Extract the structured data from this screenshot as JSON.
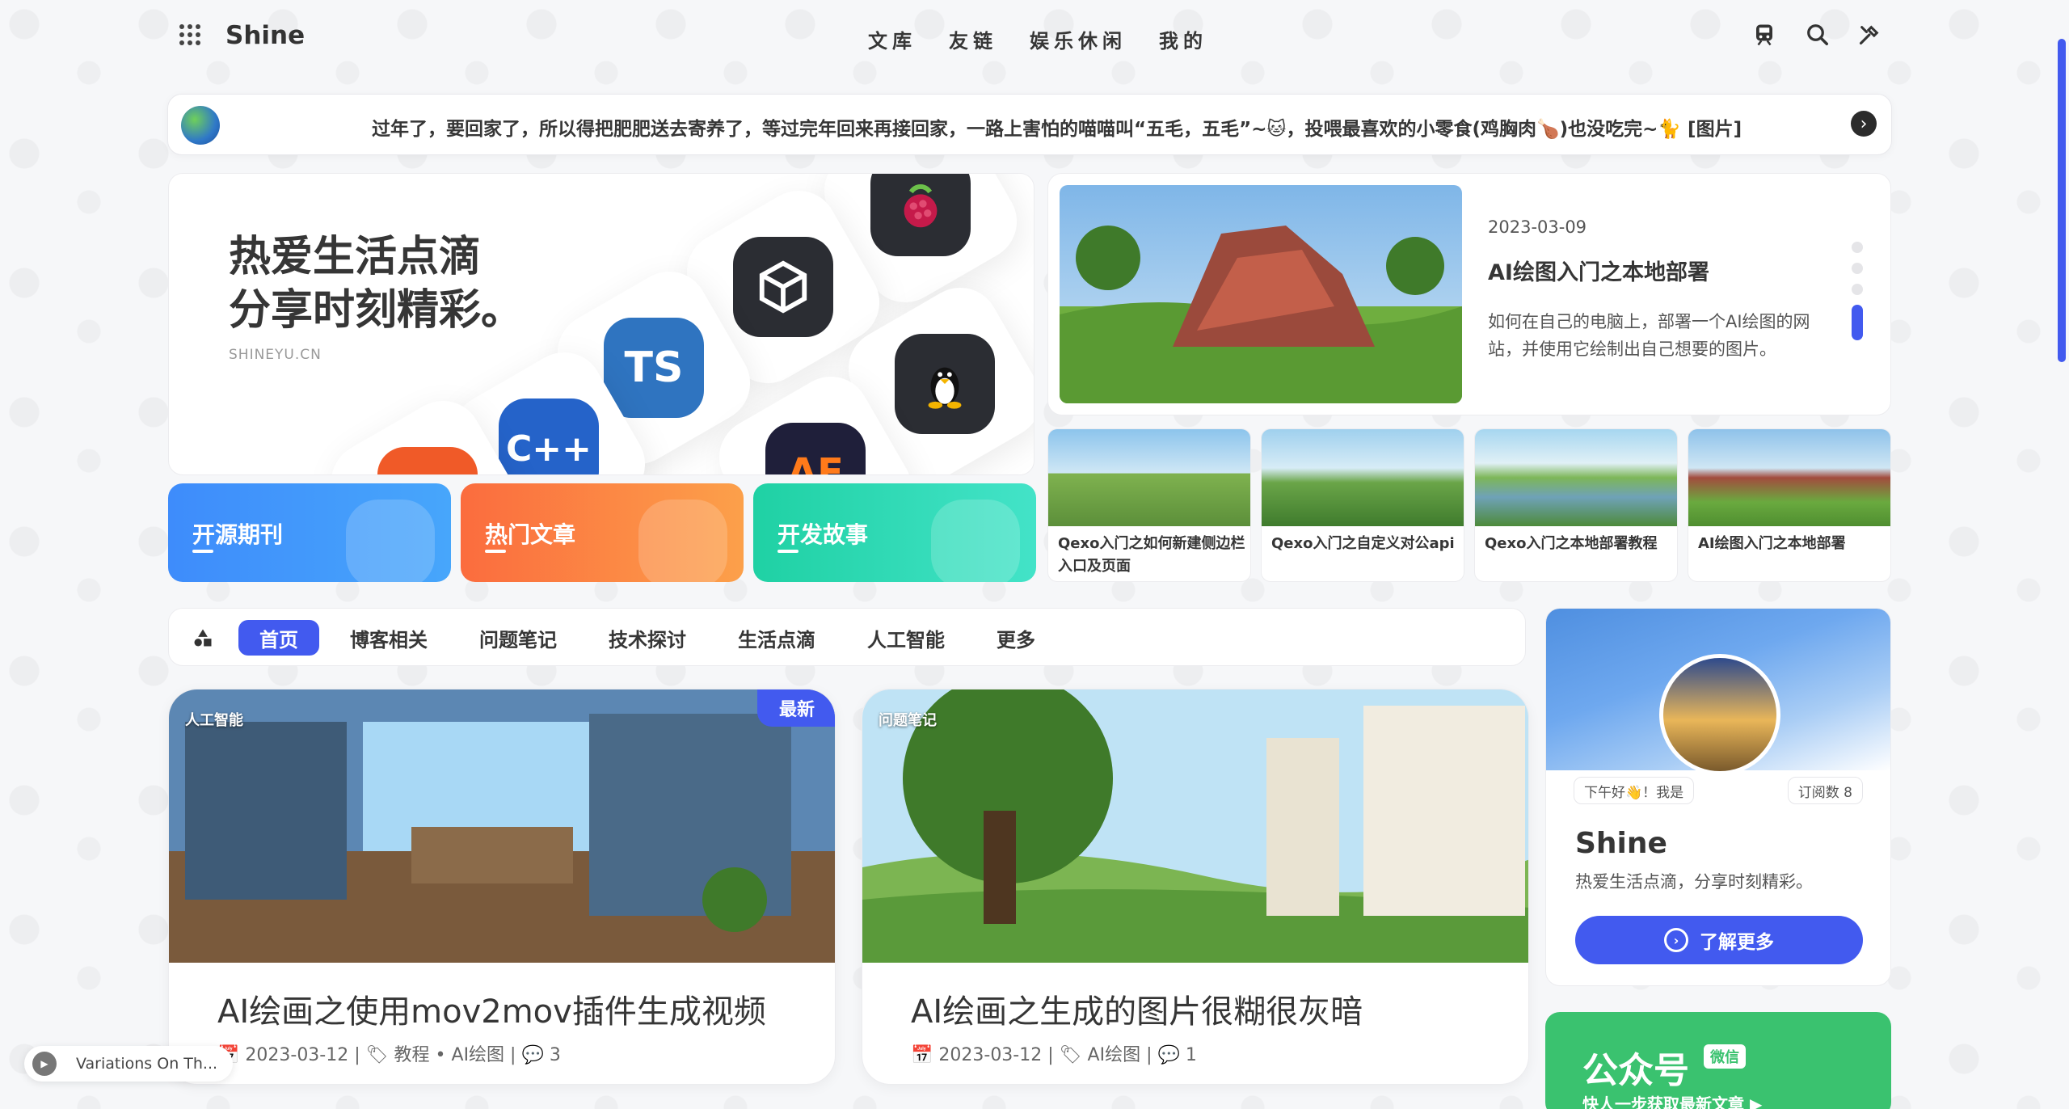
{
  "header": {
    "logo": "Shine",
    "nav": [
      "文库",
      "友链",
      "娱乐休闲",
      "我的"
    ]
  },
  "announcement": {
    "text": "过年了，要回家了，所以得把肥肥送去寄养了，等过完年回来再接回家，一路上害怕的喵喵叫“五毛，五毛”~🐱，投喂最喜欢的小零食(鸡胸肉🍗)也没吃完~🐈 [图片]"
  },
  "hero": {
    "title_line1": "热爱生活点滴",
    "title_line2": "分享时刻精彩。",
    "subtitle": "SHINEYU.CN",
    "tiles": [
      "TS",
      "C++",
      "AE"
    ]
  },
  "categories": [
    {
      "label": "开源期刊",
      "color_from": "#3e8cfb",
      "color_to": "#47a6fb"
    },
    {
      "label": "热门文章",
      "color_from": "#fb7c3e",
      "color_to": "#fca04a"
    },
    {
      "label": "开发故事",
      "color_from": "#22d3a6",
      "color_to": "#3fe0c3"
    }
  ],
  "featured": {
    "date": "2023-03-09",
    "title": "AI绘图入门之本地部署",
    "description": "如何在自己的电脑上，部署一个AI绘图的网站，并使用它绘制出自己想要的图片。"
  },
  "mini_posts": [
    {
      "title": "Qexo入门之如何新建侧边栏入口及页面"
    },
    {
      "title": "Qexo入门之自定义对公api"
    },
    {
      "title": "Qexo入门之本地部署教程"
    },
    {
      "title": "AI绘图入门之本地部署"
    }
  ],
  "tabs": [
    "首页",
    "博客相关",
    "问题笔记",
    "技术探讨",
    "生活点滴",
    "人工智能",
    "更多"
  ],
  "posts": [
    {
      "category": "人工智能",
      "badge": "最新",
      "title": "AI绘画之使用mov2mov插件生成视频",
      "meta": "📅 2023-03-12 | 🏷 教程 • AI绘图 | 💬 3"
    },
    {
      "category": "问题笔记",
      "title": "AI绘画之生成的图片很糊很灰暗",
      "meta": "📅 2023-03-12 | 🏷 AI绘图 | 💬 1"
    }
  ],
  "profile": {
    "greeting": "下午好👋！我是",
    "subscribers": "订阅数 8",
    "name": "Shine",
    "motto": "热爱生活点滴，分享时刻精彩。",
    "more_label": "了解更多"
  },
  "wechat": {
    "title": "公众号",
    "tag": "微信",
    "subtitle": "快人一步获取最新文章 ▶"
  },
  "music": {
    "track": "Variations On Th..."
  },
  "colors": {
    "accent": "#425aef"
  }
}
